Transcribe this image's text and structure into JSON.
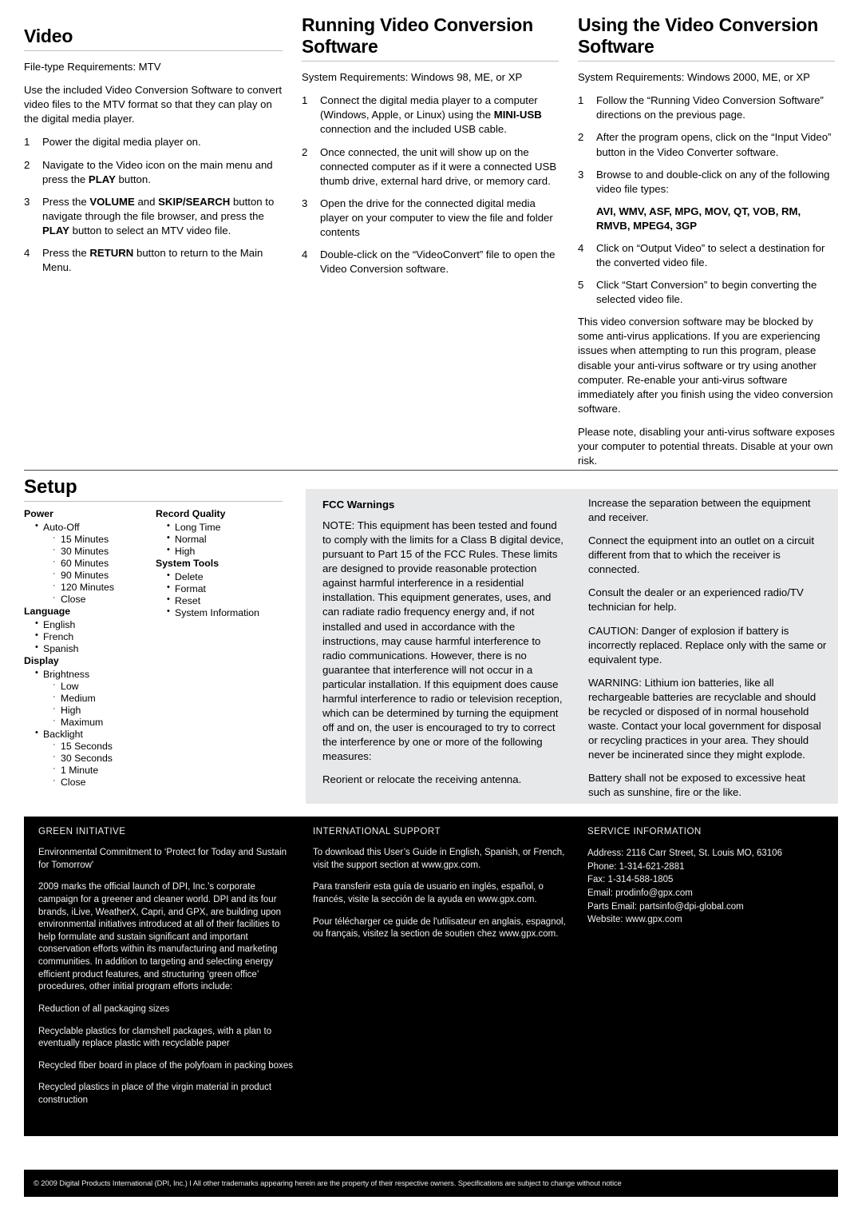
{
  "sections": {
    "video": {
      "title": "Video",
      "requirements": "File-type Requirements: MTV",
      "intro": "Use the included Video Conversion Software to convert video files to the MTV format so that they can play on the digital media player.",
      "steps": [
        {
          "num": "1",
          "text": "Power the digital media player on."
        },
        {
          "num": "2",
          "text": "Navigate to the Video icon on the main menu and press the PLAY button.",
          "bold": [
            "PLAY"
          ]
        },
        {
          "num": "3",
          "text": "Press the VOLUME and SKIP/SEARCH button to navigate through the file browser, and press the PLAY button to select an MTV video file.",
          "bold": [
            "VOLUME",
            "SKIP/SEARCH",
            "PLAY"
          ]
        },
        {
          "num": "4",
          "text": "Press the RETURN button to return to the Main Menu.",
          "bold": [
            "RETURN"
          ]
        }
      ]
    },
    "running": {
      "title": "Running Video Conversion Software",
      "requirements": "System Requirements:  Windows 98, ME, or XP",
      "steps": [
        {
          "num": "1",
          "text": "Connect the digital media player to a computer (Windows, Apple, or Linux) using the MINI-USB connection and the included USB cable.",
          "bold": [
            "MINI-USB"
          ]
        },
        {
          "num": "2",
          "text": "Once connected, the unit will show up on the connected computer as if it were a connected USB thumb drive, external hard drive, or memory card."
        },
        {
          "num": "3",
          "text": "Open the drive for the connected digital media player on your computer to view the file and folder contents"
        },
        {
          "num": "4",
          "text": "Double-click on the “VideoConvert” file to open the Video Conversion software."
        }
      ]
    },
    "using": {
      "title": "Using the Video Conversion Software",
      "requirements": "System Requirements:  Windows 2000, ME, or XP",
      "steps_a": [
        {
          "num": "1",
          "text": "Follow the “Running Video Conversion Software” directions on the previous page."
        },
        {
          "num": "2",
          "text": "After the program opens, click on the “Input Video” button in the Video Converter software."
        },
        {
          "num": "3",
          "text": "Browse to and double-click on any of the following video file types:"
        }
      ],
      "file_types": "AVI, WMV, ASF, MPG, MOV, QT, VOB, RM, RMVB, MPEG4, 3GP",
      "steps_b": [
        {
          "num": "4",
          "text": "Click on “Output Video” to select a destination for the converted video file."
        },
        {
          "num": "5",
          "text": "Click “Start Conversion” to begin converting the selected video file."
        }
      ],
      "note1": "This video conversion software may be blocked by some anti-virus applications. If you are experiencing issues when attempting to run this program, please disable your anti-virus software or try using another computer. Re-enable your anti-virus software immediately after you finish using the video conversion software.",
      "note2": "Please note, disabling your anti-virus software exposes your computer to potential threats. Disable at your own risk."
    },
    "setup": {
      "title": "Setup",
      "left_groups": [
        {
          "name": "Power",
          "items": [
            {
              "label": "Auto-Off",
              "children": [
                "15 Minutes",
                "30 Minutes",
                "60 Minutes",
                "90 Minutes",
                "120 Minutes",
                "Close"
              ]
            }
          ]
        },
        {
          "name": "Language",
          "items": [
            {
              "label": "English",
              "children": []
            },
            {
              "label": "French",
              "children": []
            },
            {
              "label": "Spanish",
              "children": []
            }
          ]
        },
        {
          "name": "Display",
          "items": [
            {
              "label": "Brightness",
              "children": [
                "Low",
                "Medium",
                "High",
                "Maximum"
              ]
            },
            {
              "label": "Backlight",
              "children": [
                "15 Seconds",
                "30 Seconds",
                "1 Minute",
                "Close"
              ]
            }
          ]
        }
      ],
      "right_groups": [
        {
          "name": "Record Quality",
          "items": [
            {
              "label": "Long Time",
              "children": []
            },
            {
              "label": "Normal",
              "children": []
            },
            {
              "label": "High",
              "children": []
            }
          ]
        },
        {
          "name": "System Tools",
          "items": [
            {
              "label": "Delete",
              "children": []
            },
            {
              "label": "Format",
              "children": []
            },
            {
              "label": "Reset",
              "children": []
            },
            {
              "label": "System Information",
              "children": []
            }
          ]
        }
      ]
    },
    "fcc": {
      "title": "FCC Warnings",
      "note": "NOTE: This equipment has been tested and found to comply with the limits for a Class B digital device, pursuant to Part 15 of the FCC Rules. These limits are designed to provide reasonable protection against harmful interference in a residential installation. This equipment generates, uses, and can radiate radio frequency energy and, if not installed and used in accordance with the instructions, may cause harmful interference to radio communications. However, there is no guarantee that interference will not occur in a particular installation. If this equipment does cause harmful interference to radio or television reception, which can be determined by turning the equipment off and on, the user is encouraged to  try to correct the interference by one or more of the following measures:",
      "measure1": "Reorient or relocate the receiving antenna.",
      "measure2": "Increase the separation between the equipment and receiver.",
      "measure3": "Connect the equipment into an outlet on a circuit different from that to which the receiver is connected.",
      "measure4": "Consult the dealer or an experienced radio/TV technician for help.",
      "caution": "CAUTION:  Danger of explosion if battery is incorrectly replaced. Replace only with the same or equivalent type.",
      "warning": "WARNING: Lithium ion batteries, like all rechargeable batteries are recyclable and should be recycled or disposed of in normal household waste. Contact your local government for disposal or recycling practices in your area. They should never be incinerated since they might explode.",
      "battery": "Battery shall not be exposed to excessive heat such as sunshine, fire or the like."
    },
    "green": {
      "kicker": "GREEN INITIATIVE",
      "commitment": "Environmental Commitment to ‘Protect for Today and Sustain for Tomorrow'",
      "body": "2009 marks the official launch of DPI, Inc.’s corporate campaign for a greener and cleaner world. DPI and its four brands, iLive, WeatherX, Capri, and GPX, are building upon environmental initiatives introduced at all of their facilities to help formulate and sustain significant and important conservation efforts within its manufacturing and marketing communities. In addition to targeting and selecting energy efficient product features, and structuring ‘green office’ procedures, other initial program efforts include:",
      "bullets": [
        "Reduction of all packaging sizes",
        "Recyclable plastics for clamshell packages, with a plan to eventually replace plastic with recyclable paper",
        "Recycled fiber board in place of the polyfoam in packing boxes",
        "Recycled plastics in place of the virgin material in product construction"
      ]
    },
    "international": {
      "kicker": "INTERNATIONAL SUPPORT",
      "english": "To download this User’s Guide in English, Spanish, or French, visit the support section  at www.gpx.com.",
      "spanish": "Para transferir esta guía de usuario en inglés, español, o francés, visite la sección de la ayuda en www.gpx.com.",
      "french": "Pour télécharger ce guide de l'utilisateur en anglais, espagnol, ou français, visitez la section de soutien chez www.gpx.com."
    },
    "service": {
      "kicker": "SERVICE INFORMATION",
      "address": "Address: 2116 Carr Street, St. Louis MO, 63106",
      "phone": "Phone: 1-314-621-2881",
      "fax": "Fax: 1-314-588-1805",
      "email": "Email: prodinfo@gpx.com",
      "parts_email": "Parts Email: partsinfo@dpi-global.com",
      "website": "Website: www.gpx.com"
    }
  },
  "footer": {
    "copyright": "© 2009 Digital Products International (DPI, Inc.)  I  All other trademarks appearing herein are the property of their respective owners. Specifications are subject to change without notice"
  },
  "colors": {
    "gray_panel": "#e7e8ea",
    "black_panel": "#000000",
    "rule": "#b9c2c6"
  }
}
